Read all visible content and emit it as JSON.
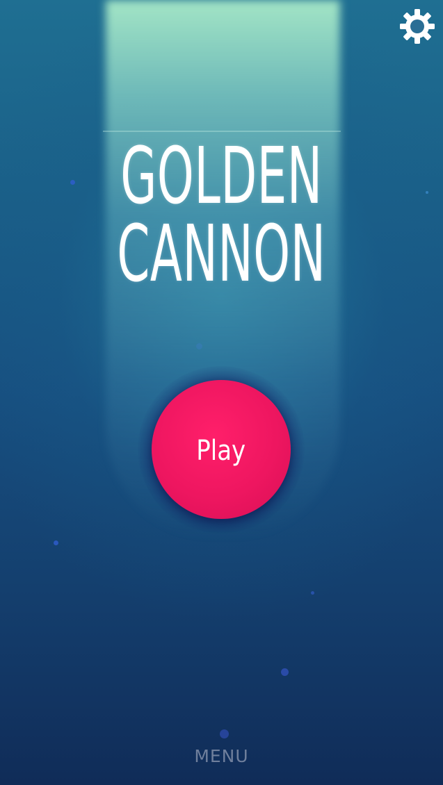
{
  "game": {
    "title_line1": "GOLDEN",
    "title_line2": "CANNON"
  },
  "buttons": {
    "play_label": "Play",
    "menu_label": "MENU",
    "settings_icon": "gear-icon"
  },
  "colors": {
    "play_button": "#ee1660",
    "background_top": "#1f6f92",
    "background_bottom": "#102c58",
    "beam": "#aeebc8",
    "menu_text": "#6f7f9c",
    "title_text": "#ffffff"
  }
}
